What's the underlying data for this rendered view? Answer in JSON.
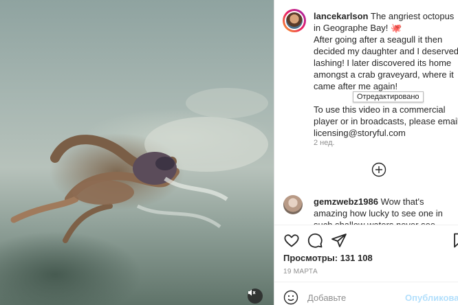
{
  "post": {
    "username": "lancekarlson",
    "caption": "The angriest octopus in Geographe Bay! 🐙\nAfter going after a seagull it then decided my daughter and I deserved lashing! I later discovered its home amongst a crab graveyard, where it came after me again!\n\nTo use this video in a commercial player or in broadcasts, please email licensing@storyful.com",
    "edited_tooltip": "Отредактировано",
    "time_ago": "2 нед."
  },
  "comment": {
    "username": "gemzwebz1986",
    "text": "Wow that's amazing how lucky to see one in such shallow waters never see"
  },
  "stats": {
    "likes": "Просмотры: 131 108",
    "date": "19 МАРТА"
  },
  "comment_box": {
    "placeholder": "Добавьте",
    "post_label": "Опубликовать"
  },
  "icons": {
    "mute": "speaker-muted-icon",
    "load_more": "plus-circle-icon",
    "like": "heart-icon",
    "comment": "comment-bubble-icon",
    "share": "paper-plane-icon",
    "save": "bookmark-icon",
    "emoji": "smiley-icon"
  }
}
